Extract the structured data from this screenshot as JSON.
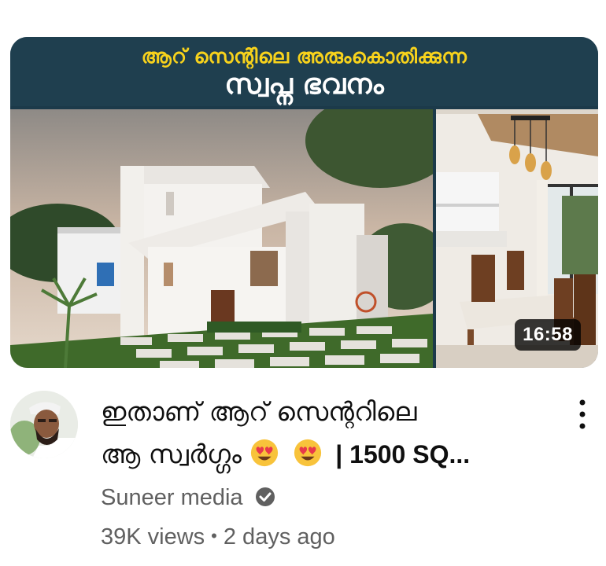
{
  "thumbnail": {
    "banner_line1": "ആറ് സെന്റിലെ അരുംകൊതിക്കുന്ന",
    "banner_line2": "സ്വപ്ന ഭവനം",
    "duration": "16:58",
    "banner_color": "#1f3f4f",
    "banner_accent": "#f7d21c"
  },
  "video": {
    "title_line1": "ഇതാണ് ആറ് സെന്ററിലെ",
    "title_line2_text": "ആ സ്വർഗ്ഗം",
    "title_line2_suffix": "| 1500 SQ...",
    "emoji_icon": "heart-eyes-emoji"
  },
  "channel": {
    "name": "Suneer media",
    "verified_icon": "verified-check-icon"
  },
  "stats": {
    "views": "39K views",
    "separator": "•",
    "age": "2 days ago"
  },
  "menu_icon": "more-vertical-icon",
  "colors": {
    "title": "#0f0f0f",
    "meta": "#606060"
  }
}
